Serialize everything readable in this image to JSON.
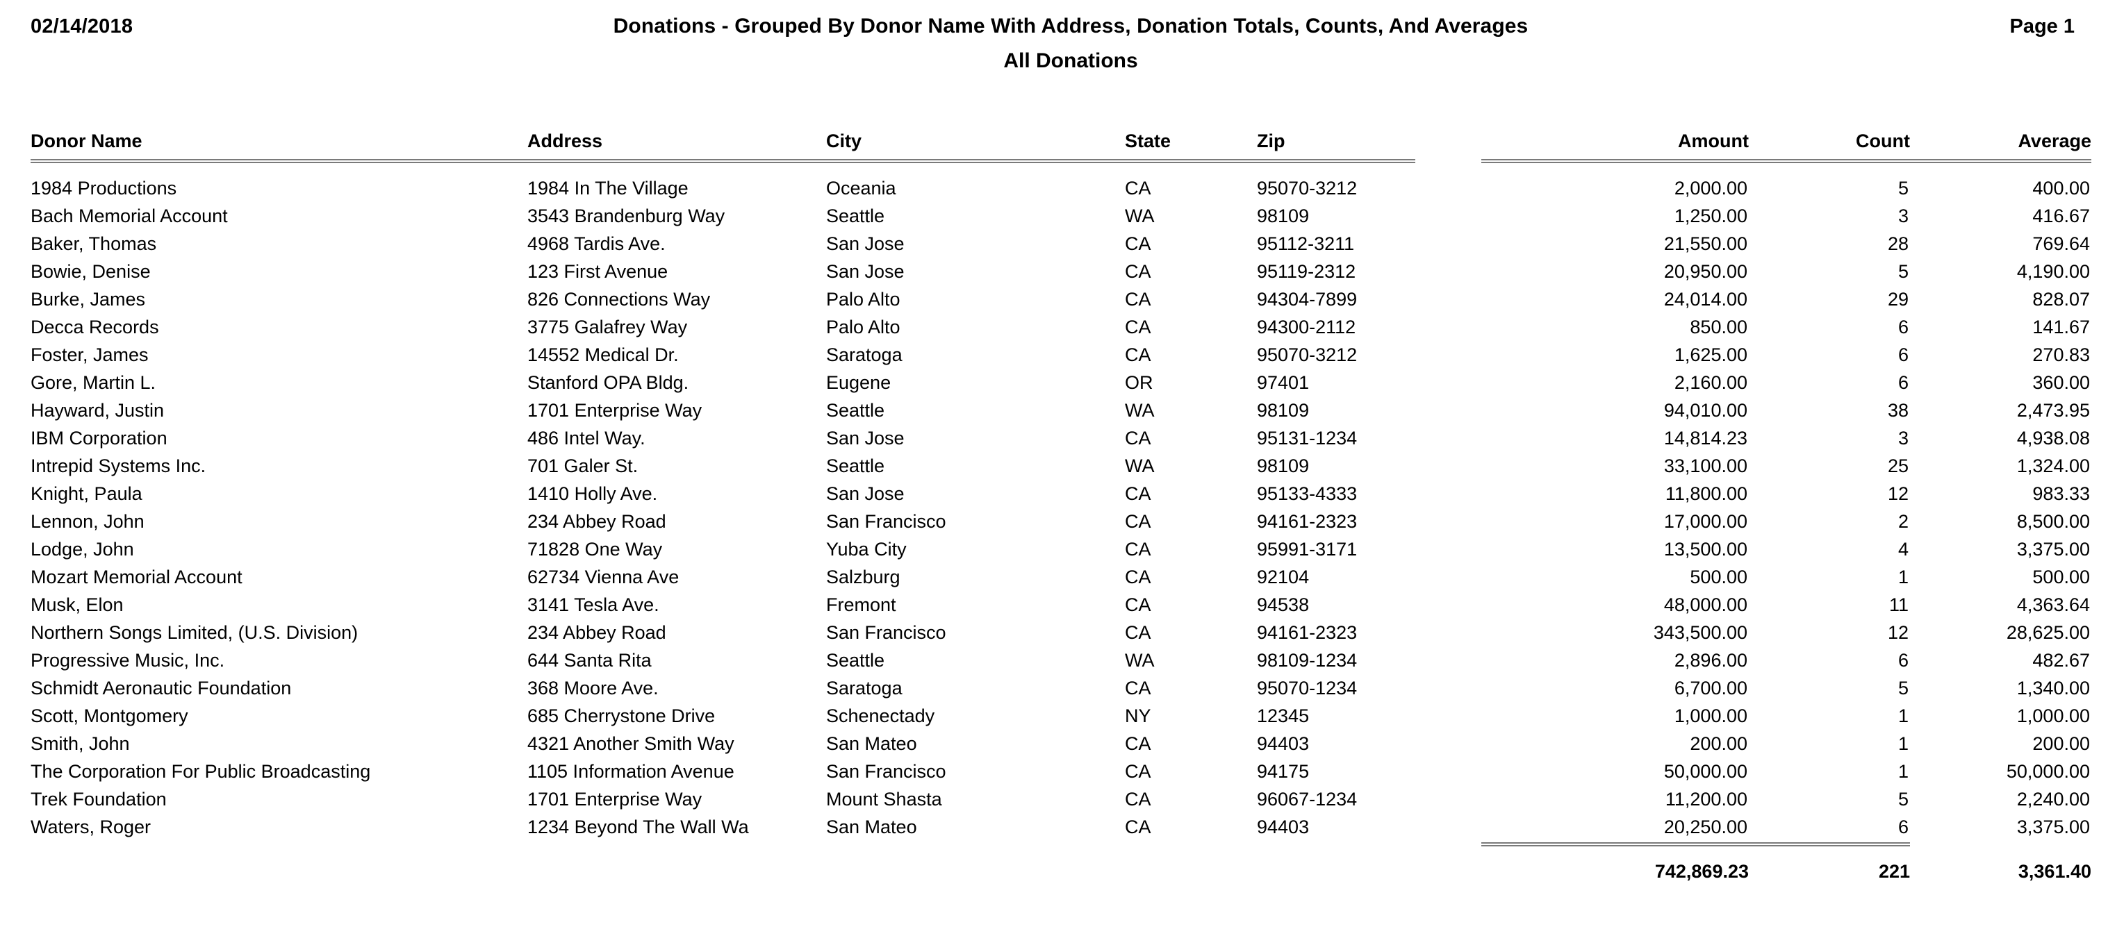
{
  "header": {
    "date": "02/14/2018",
    "title": "Donations - Grouped By Donor Name With Address, Donation Totals, Counts, And Averages",
    "subtitle": "All Donations",
    "page_label": "Page 1"
  },
  "table": {
    "columns": [
      {
        "key": "donor",
        "label": "Donor Name",
        "align": "left"
      },
      {
        "key": "address",
        "label": "Address",
        "align": "left"
      },
      {
        "key": "city",
        "label": "City",
        "align": "left"
      },
      {
        "key": "state",
        "label": "State",
        "align": "left"
      },
      {
        "key": "zip",
        "label": "Zip",
        "align": "left"
      },
      {
        "key": "amount",
        "label": "Amount",
        "align": "right"
      },
      {
        "key": "count",
        "label": "Count",
        "align": "right"
      },
      {
        "key": "average",
        "label": "Average",
        "align": "right"
      }
    ],
    "rows": [
      {
        "donor": "1984 Productions",
        "address": "1984 In The Village",
        "city": "Oceania",
        "state": "CA",
        "zip": "95070-3212",
        "amount": "2,000.00",
        "count": "5",
        "average": "400.00"
      },
      {
        "donor": "Bach Memorial Account",
        "address": "3543 Brandenburg Way",
        "city": "Seattle",
        "state": "WA",
        "zip": "98109",
        "amount": "1,250.00",
        "count": "3",
        "average": "416.67"
      },
      {
        "donor": "Baker, Thomas",
        "address": "4968 Tardis Ave.",
        "city": "San Jose",
        "state": "CA",
        "zip": "95112-3211",
        "amount": "21,550.00",
        "count": "28",
        "average": "769.64"
      },
      {
        "donor": "Bowie, Denise",
        "address": "123 First Avenue",
        "city": "San Jose",
        "state": "CA",
        "zip": "95119-2312",
        "amount": "20,950.00",
        "count": "5",
        "average": "4,190.00"
      },
      {
        "donor": "Burke, James",
        "address": "826 Connections Way",
        "city": "Palo Alto",
        "state": "CA",
        "zip": "94304-7899",
        "amount": "24,014.00",
        "count": "29",
        "average": "828.07"
      },
      {
        "donor": "Decca Records",
        "address": "3775 Galafrey Way",
        "city": "Palo Alto",
        "state": "CA",
        "zip": "94300-2112",
        "amount": "850.00",
        "count": "6",
        "average": "141.67"
      },
      {
        "donor": "Foster, James",
        "address": "14552 Medical Dr.",
        "city": "Saratoga",
        "state": "CA",
        "zip": "95070-3212",
        "amount": "1,625.00",
        "count": "6",
        "average": "270.83"
      },
      {
        "donor": "Gore, Martin L.",
        "address": "Stanford OPA Bldg.",
        "city": "Eugene",
        "state": "OR",
        "zip": "97401",
        "amount": "2,160.00",
        "count": "6",
        "average": "360.00"
      },
      {
        "donor": "Hayward, Justin",
        "address": "1701 Enterprise Way",
        "city": "Seattle",
        "state": "WA",
        "zip": "98109",
        "amount": "94,010.00",
        "count": "38",
        "average": "2,473.95"
      },
      {
        "donor": "IBM Corporation",
        "address": "486 Intel Way.",
        "city": "San Jose",
        "state": "CA",
        "zip": "95131-1234",
        "amount": "14,814.23",
        "count": "3",
        "average": "4,938.08"
      },
      {
        "donor": "Intrepid Systems Inc.",
        "address": "701 Galer St.",
        "city": "Seattle",
        "state": "WA",
        "zip": "98109",
        "amount": "33,100.00",
        "count": "25",
        "average": "1,324.00"
      },
      {
        "donor": "Knight, Paula",
        "address": "1410 Holly Ave.",
        "city": "San Jose",
        "state": "CA",
        "zip": "95133-4333",
        "amount": "11,800.00",
        "count": "12",
        "average": "983.33"
      },
      {
        "donor": "Lennon, John",
        "address": "234 Abbey Road",
        "city": "San Francisco",
        "state": "CA",
        "zip": "94161-2323",
        "amount": "17,000.00",
        "count": "2",
        "average": "8,500.00"
      },
      {
        "donor": "Lodge, John",
        "address": "71828 One Way",
        "city": "Yuba City",
        "state": "CA",
        "zip": "95991-3171",
        "amount": "13,500.00",
        "count": "4",
        "average": "3,375.00"
      },
      {
        "donor": "Mozart Memorial Account",
        "address": "62734 Vienna Ave",
        "city": "Salzburg",
        "state": "CA",
        "zip": "92104",
        "amount": "500.00",
        "count": "1",
        "average": "500.00"
      },
      {
        "donor": "Musk, Elon",
        "address": "3141 Tesla Ave.",
        "city": "Fremont",
        "state": "CA",
        "zip": "94538",
        "amount": "48,000.00",
        "count": "11",
        "average": "4,363.64"
      },
      {
        "donor": "Northern Songs Limited, (U.S. Division)",
        "address": "234 Abbey Road",
        "city": "San Francisco",
        "state": "CA",
        "zip": "94161-2323",
        "amount": "343,500.00",
        "count": "12",
        "average": "28,625.00"
      },
      {
        "donor": "Progressive Music, Inc.",
        "address": "644 Santa Rita",
        "city": "Seattle",
        "state": "WA",
        "zip": "98109-1234",
        "amount": "2,896.00",
        "count": "6",
        "average": "482.67"
      },
      {
        "donor": "Schmidt Aeronautic Foundation",
        "address": "368 Moore Ave.",
        "city": "Saratoga",
        "state": "CA",
        "zip": "95070-1234",
        "amount": "6,700.00",
        "count": "5",
        "average": "1,340.00"
      },
      {
        "donor": "Scott, Montgomery",
        "address": "685 Cherrystone Drive",
        "city": "Schenectady",
        "state": "NY",
        "zip": "12345",
        "amount": "1,000.00",
        "count": "1",
        "average": "1,000.00"
      },
      {
        "donor": "Smith, John",
        "address": "4321 Another Smith Way",
        "city": "San Mateo",
        "state": "CA",
        "zip": "94403",
        "amount": "200.00",
        "count": "1",
        "average": "200.00"
      },
      {
        "donor": "The Corporation For Public Broadcasting",
        "address": "1105 Information Avenue",
        "city": "San Francisco",
        "state": "CA",
        "zip": "94175",
        "amount": "50,000.00",
        "count": "1",
        "average": "50,000.00"
      },
      {
        "donor": "Trek Foundation",
        "address": "1701 Enterprise Way",
        "city": "Mount Shasta",
        "state": "CA",
        "zip": "96067-1234",
        "amount": "11,200.00",
        "count": "5",
        "average": "2,240.00"
      },
      {
        "donor": "Waters, Roger",
        "address": "1234 Beyond The Wall Wa",
        "city": "San Mateo",
        "state": "CA",
        "zip": "94403",
        "amount": "20,250.00",
        "count": "6",
        "average": "3,375.00"
      }
    ],
    "totals": {
      "amount": "742,869.23",
      "count": "221",
      "average": "3,361.40"
    }
  }
}
